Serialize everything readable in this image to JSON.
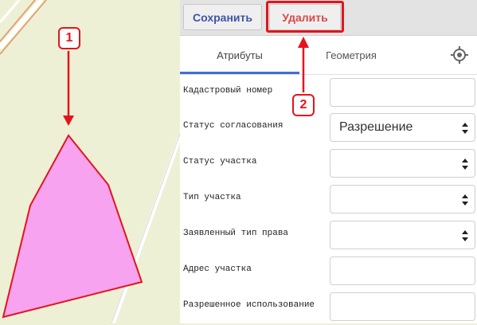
{
  "toolbar": {
    "save_label": "Сохранить",
    "delete_label": "Удалить"
  },
  "tabs": [
    {
      "label": "Атрибуты",
      "active": true
    },
    {
      "label": "Геометрия",
      "active": false
    }
  ],
  "locate_icon": "crosshair-icon",
  "fields": [
    {
      "label": "Кадастровый номер",
      "type": "text",
      "value": ""
    },
    {
      "label": "Статус согласования",
      "type": "select",
      "value": "Разрешение"
    },
    {
      "label": "Статус участка",
      "type": "select",
      "value": ""
    },
    {
      "label": "Тип участка",
      "type": "select",
      "value": ""
    },
    {
      "label": "Заявленный тип права",
      "type": "select",
      "value": ""
    },
    {
      "label": "Адрес участка",
      "type": "text",
      "value": ""
    },
    {
      "label": "Разрешенное использование",
      "type": "text",
      "value": ""
    }
  ],
  "annotations": {
    "marker1": "1",
    "marker2": "2",
    "color": "#e4141b"
  },
  "map": {
    "polygon_fill": "#f7a3f0",
    "polygon_stroke": "#e4141b",
    "background": "#eef0d6"
  }
}
